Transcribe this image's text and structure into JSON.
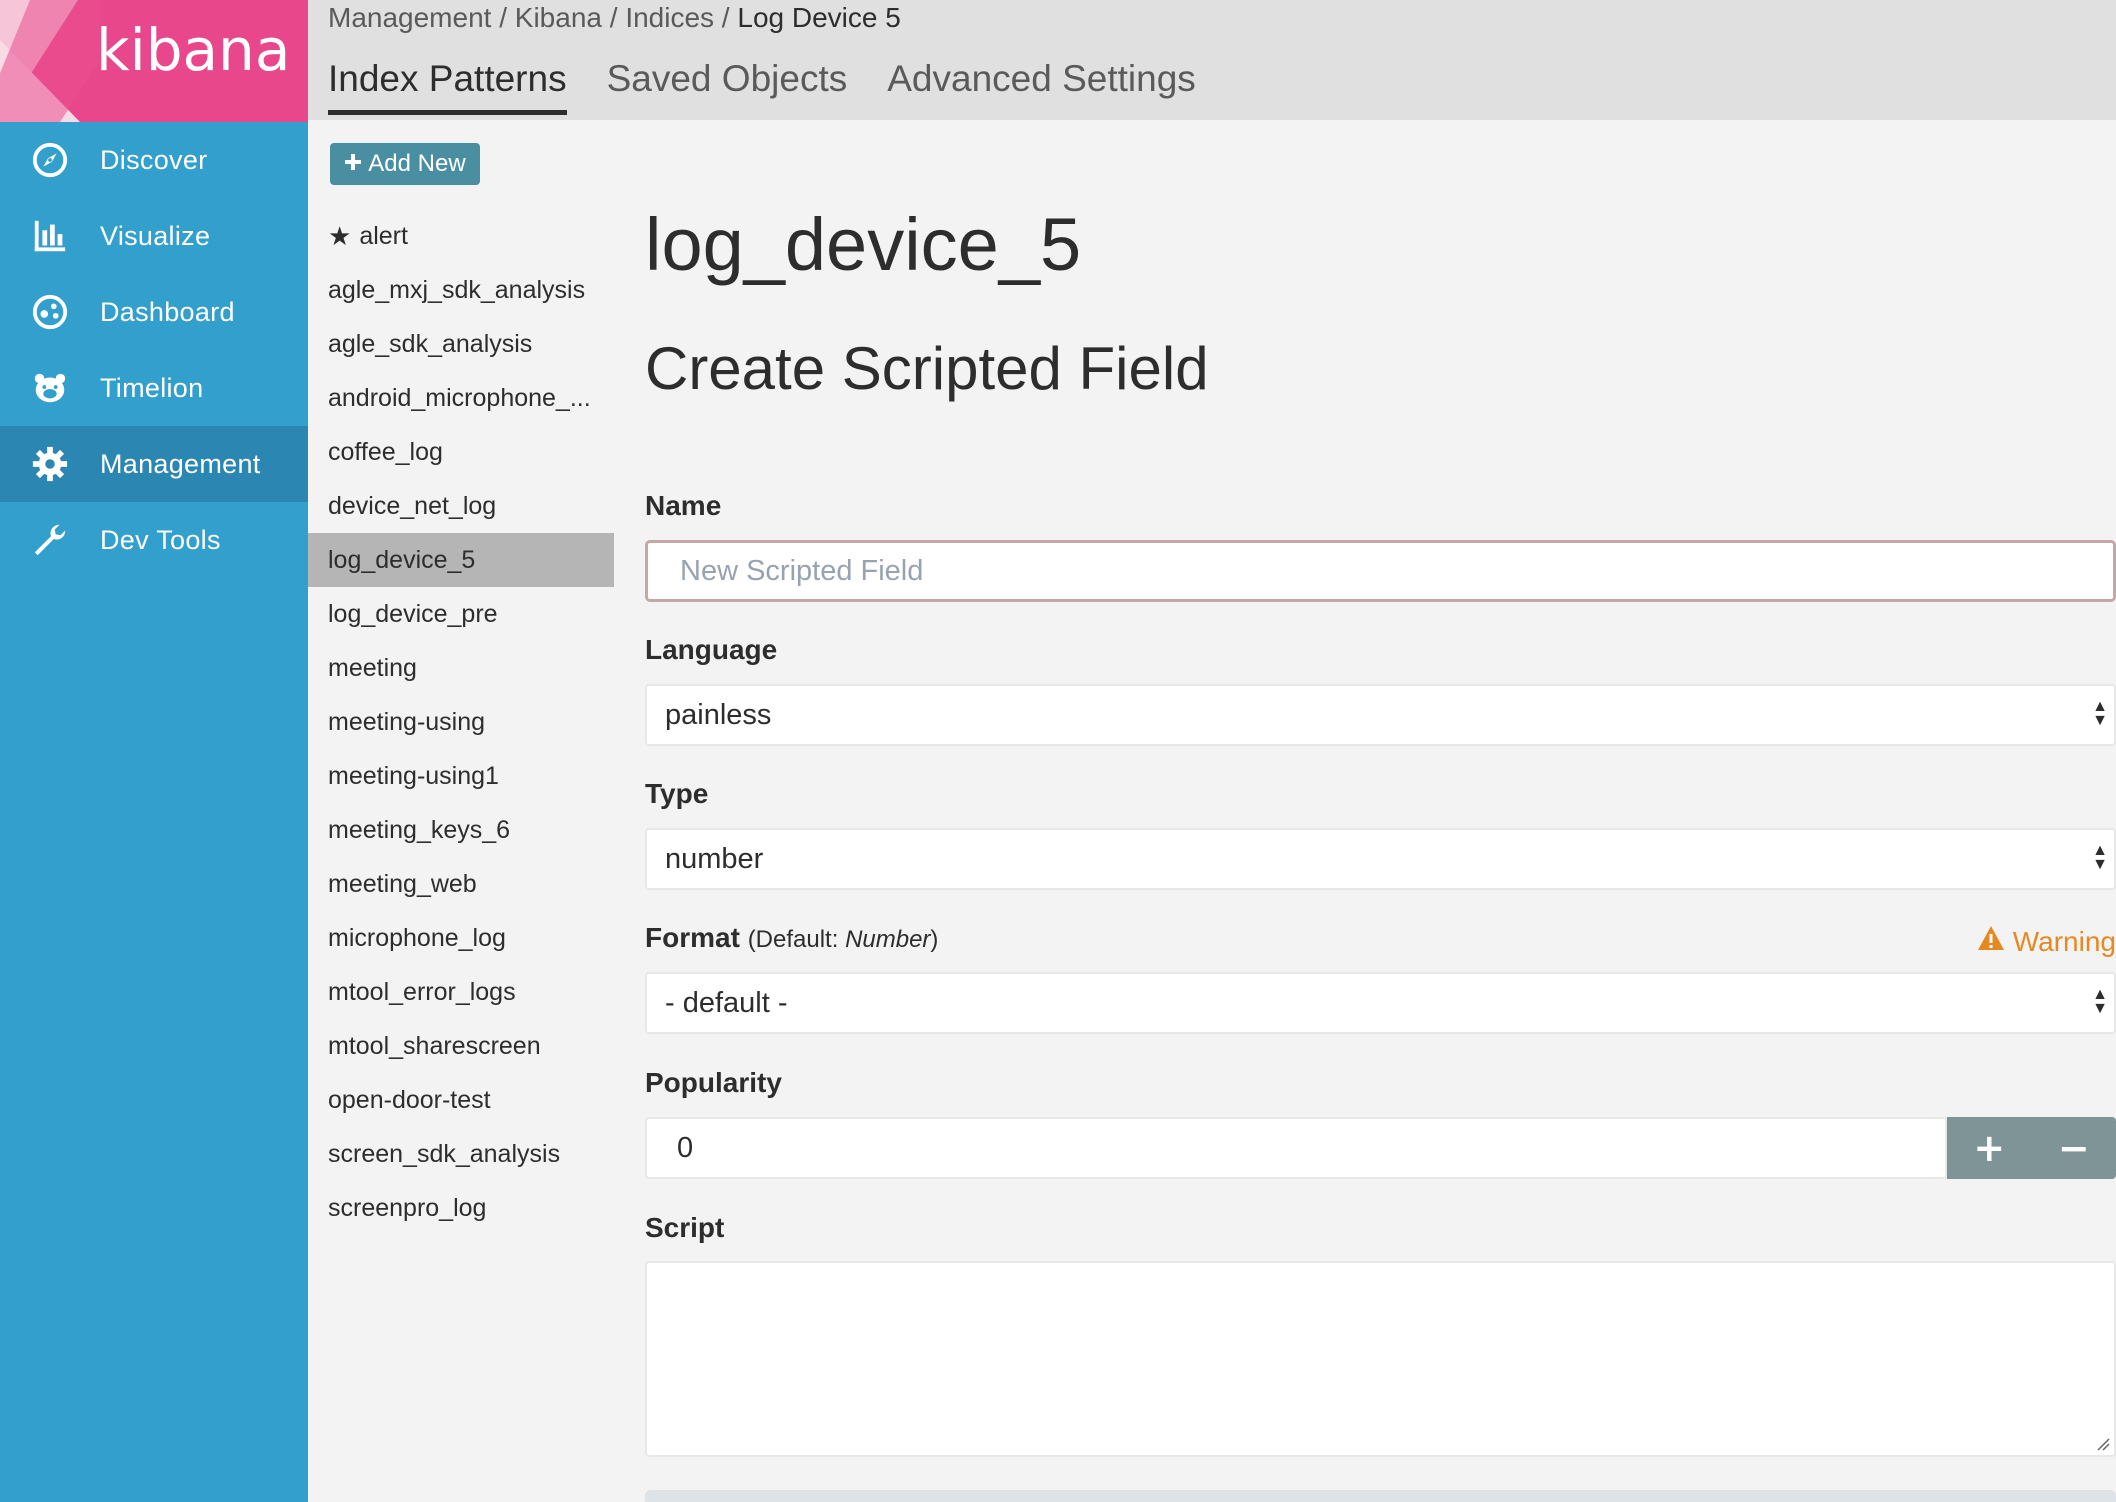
{
  "app": {
    "logo_text": "kibana"
  },
  "nav": [
    {
      "label": "Discover",
      "icon": "compass-icon"
    },
    {
      "label": "Visualize",
      "icon": "bar-chart-icon"
    },
    {
      "label": "Dashboard",
      "icon": "dashboard-icon"
    },
    {
      "label": "Timelion",
      "icon": "timelion-bear-icon"
    },
    {
      "label": "Management",
      "icon": "gear-icon",
      "active": true
    },
    {
      "label": "Dev Tools",
      "icon": "wrench-icon"
    }
  ],
  "breadcrumb": {
    "parts": [
      "Management",
      "Kibana",
      "Indices"
    ],
    "separator": " / ",
    "current": "Log Device 5"
  },
  "tabs": [
    {
      "label": "Index Patterns",
      "active": true
    },
    {
      "label": "Saved Objects"
    },
    {
      "label": "Advanced Settings"
    }
  ],
  "add_button": {
    "icon": "plus-icon",
    "label": "Add New"
  },
  "index_patterns": [
    {
      "label": "alert",
      "default": true
    },
    {
      "label": "agle_mxj_sdk_analysis"
    },
    {
      "label": "agle_sdk_analysis"
    },
    {
      "label": "android_microphone_..."
    },
    {
      "label": "coffee_log"
    },
    {
      "label": "device_net_log"
    },
    {
      "label": "log_device_5",
      "active": true
    },
    {
      "label": "log_device_pre"
    },
    {
      "label": "meeting"
    },
    {
      "label": "meeting-using"
    },
    {
      "label": "meeting-using1"
    },
    {
      "label": "meeting_keys_6"
    },
    {
      "label": "meeting_web"
    },
    {
      "label": "microphone_log"
    },
    {
      "label": "mtool_error_logs"
    },
    {
      "label": "mtool_sharescreen"
    },
    {
      "label": "open-door-test"
    },
    {
      "label": "screen_sdk_analysis"
    },
    {
      "label": "screenpro_log"
    }
  ],
  "form": {
    "index_title": "log_device_5",
    "heading": "Create Scripted Field",
    "name_label": "Name",
    "name_placeholder": "New Scripted Field",
    "name_value": "",
    "language_label": "Language",
    "language_value": "painless",
    "type_label": "Type",
    "type_value": "number",
    "format_label": "Format",
    "format_hint_prefix": "(Default: ",
    "format_hint_value": "Number",
    "format_hint_suffix": ")",
    "format_value": "- default -",
    "warning_label": "Warning",
    "popularity_label": "Popularity",
    "popularity_value": "0",
    "increment_label": "+",
    "decrement_label": "−",
    "script_label": "Script",
    "script_value": ""
  },
  "colors": {
    "sidebar": "#339fcc",
    "logo_bg": "#e8488b",
    "active_nav": "#2b86b1",
    "warning": "#e58a22",
    "stepper": "#7f9496"
  }
}
